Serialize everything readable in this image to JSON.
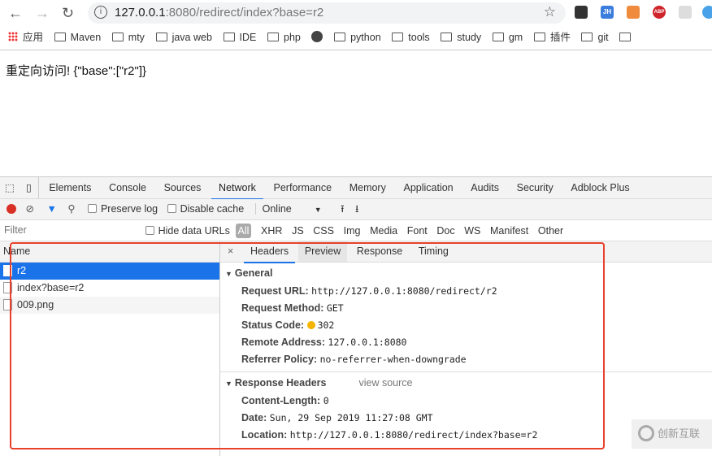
{
  "browser": {
    "url_host": "127.0.0.1",
    "url_rest": ":8080/redirect/index?base=r2",
    "extensions": [
      {
        "name": "qr-code-icon",
        "label": "",
        "color": "#333333"
      },
      {
        "name": "jh-extension-icon",
        "label": "JH",
        "color": "#3b7ddd"
      },
      {
        "name": "extension-orange-icon",
        "label": "",
        "color": "#f08a3c"
      },
      {
        "name": "adblock-plus-icon",
        "label": "ABP",
        "color": "#d0242b"
      },
      {
        "name": "extension-gray-icon",
        "label": "",
        "color": "#bbbbbb"
      }
    ]
  },
  "bookmarks": [
    "应用",
    "Maven",
    "mty",
    "java web",
    "IDE",
    "php",
    "",
    "python",
    "tools",
    "study",
    "gm",
    "插件",
    "git",
    ""
  ],
  "page": {
    "text": "重定向访问! {\"base\":[\"r2\"]}"
  },
  "devtools": {
    "tabs": [
      "Elements",
      "Console",
      "Sources",
      "Network",
      "Performance",
      "Memory",
      "Application",
      "Audits",
      "Security",
      "Adblock Plus"
    ],
    "active_tab": "Network",
    "toolbar": {
      "preserve_log": "Preserve log",
      "disable_cache": "Disable cache",
      "throttle": "Online"
    },
    "filter": {
      "placeholder": "Filter",
      "hide_data_urls": "Hide data URLs",
      "types": [
        "All",
        "XHR",
        "JS",
        "CSS",
        "Img",
        "Media",
        "Font",
        "Doc",
        "WS",
        "Manifest",
        "Other"
      ]
    },
    "name_header": "Name",
    "requests": [
      "r2",
      "index?base=r2",
      "009.png"
    ],
    "detail_tabs": [
      "Headers",
      "Preview",
      "Response",
      "Timing"
    ],
    "close": "×",
    "general": {
      "title": "General",
      "rows": [
        {
          "k": "Request URL:",
          "v": "http://127.0.0.1:8080/redirect/r2"
        },
        {
          "k": "Request Method:",
          "v": "GET"
        },
        {
          "k": "Status Code:",
          "v": "302"
        },
        {
          "k": "Remote Address:",
          "v": "127.0.0.1:8080"
        },
        {
          "k": "Referrer Policy:",
          "v": "no-referrer-when-downgrade"
        }
      ]
    },
    "response_headers": {
      "title": "Response Headers",
      "view_source": "view source",
      "rows": [
        {
          "k": "Content-Length:",
          "v": "0"
        },
        {
          "k": "Date:",
          "v": "Sun, 29 Sep 2019 11:27:08 GMT"
        },
        {
          "k": "Location:",
          "v": "http://127.0.0.1:8080/redirect/index?base=r2"
        }
      ]
    }
  },
  "watermark": "创新互联",
  "colors": {
    "accent": "#1a73e8",
    "highlight": "#e8412c",
    "record": "#d93025",
    "status_warning": "#f5b400"
  }
}
